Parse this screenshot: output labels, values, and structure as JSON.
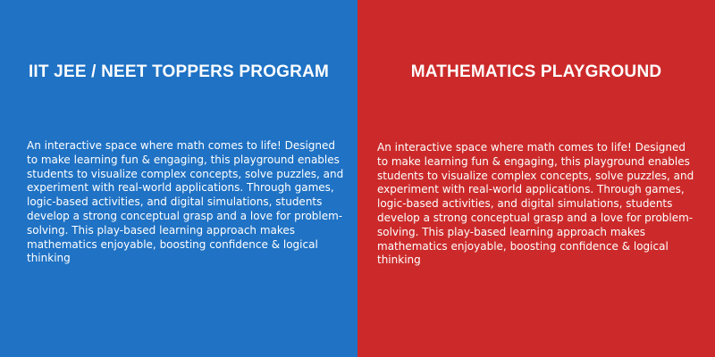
{
  "colors": {
    "left_background": "#1f72c4",
    "right_background": "#cc2a2a",
    "text": "#ffffff"
  },
  "left_panel": {
    "title": "IIT JEE / NEET TOPPERS PROGRAM",
    "body": "An interactive space where math comes to life! Designed to make learning fun & engaging, this playground enables students to visualize complex concepts, solve puzzles, and experiment with real-world applications. Through games, logic-based activities, and digital simulations, students develop a strong conceptual grasp and a love for problem-solving. This play-based learning approach makes mathematics enjoyable, boosting confidence & logical thinking"
  },
  "right_panel": {
    "title": "MATHEMATICS PLAYGROUND",
    "body": "An interactive space where math comes to life! Designed to make learning fun & engaging, this playground enables students to visualize complex concepts, solve puzzles, and experiment with real-world applications. Through games, logic-based activities, and digital simulations, students develop a strong conceptual grasp and a love for problem-solving. This play-based learning approach makes mathematics enjoyable, boosting confidence & logical thinking"
  }
}
